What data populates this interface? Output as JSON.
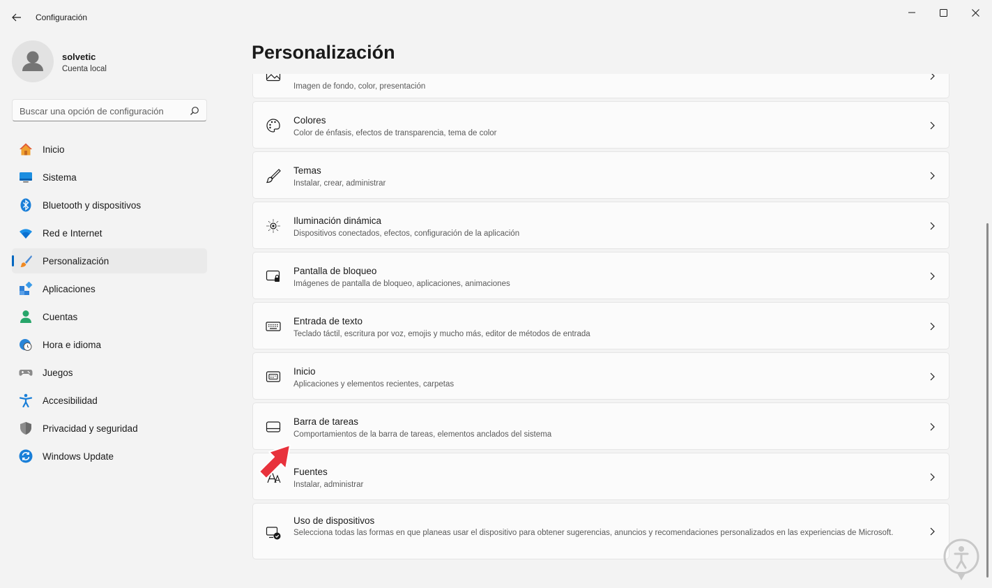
{
  "window": {
    "title": "Configuración"
  },
  "profile": {
    "name": "solvetic",
    "account_type": "Cuenta local"
  },
  "search": {
    "placeholder": "Buscar una opción de configuración"
  },
  "nav": {
    "items": [
      {
        "label": "Inicio",
        "icon": "home-icon"
      },
      {
        "label": "Sistema",
        "icon": "monitor-icon"
      },
      {
        "label": "Bluetooth y dispositivos",
        "icon": "bluetooth-icon"
      },
      {
        "label": "Red e Internet",
        "icon": "wifi-icon"
      },
      {
        "label": "Personalización",
        "icon": "paintbrush-icon",
        "active": true
      },
      {
        "label": "Aplicaciones",
        "icon": "apps-icon"
      },
      {
        "label": "Cuentas",
        "icon": "person-icon"
      },
      {
        "label": "Hora e idioma",
        "icon": "globe-clock-icon"
      },
      {
        "label": "Juegos",
        "icon": "gamepad-icon"
      },
      {
        "label": "Accesibilidad",
        "icon": "accessibility-icon"
      },
      {
        "label": "Privacidad y seguridad",
        "icon": "shield-icon"
      },
      {
        "label": "Windows Update",
        "icon": "update-icon"
      }
    ]
  },
  "main": {
    "title": "Personalización",
    "cards": [
      {
        "title": "",
        "desc": "Imagen de fondo, color, presentación",
        "icon": "image-icon"
      },
      {
        "title": "Colores",
        "desc": "Color de énfasis, efectos de transparencia, tema de color",
        "icon": "palette-icon"
      },
      {
        "title": "Temas",
        "desc": "Instalar, crear, administrar",
        "icon": "brush-icon"
      },
      {
        "title": "Iluminación dinámica",
        "desc": "Dispositivos conectados, efectos, configuración de la aplicación",
        "icon": "sun-icon"
      },
      {
        "title": "Pantalla de bloqueo",
        "desc": "Imágenes de pantalla de bloqueo, aplicaciones, animaciones",
        "icon": "lock-screen-icon"
      },
      {
        "title": "Entrada de texto",
        "desc": "Teclado táctil, escritura por voz, emojis y mucho más, editor de métodos de entrada",
        "icon": "keyboard-icon"
      },
      {
        "title": "Inicio",
        "desc": "Aplicaciones y elementos recientes, carpetas",
        "icon": "start-icon"
      },
      {
        "title": "Barra de tareas",
        "desc": "Comportamientos de la barra de tareas, elementos anclados del sistema",
        "icon": "taskbar-icon"
      },
      {
        "title": "Fuentes",
        "desc": "Instalar, administrar",
        "icon": "fonts-icon"
      },
      {
        "title": "Uso de dispositivos",
        "desc": "Selecciona todas las formas en que planeas usar el dispositivo para obtener sugerencias, anuncios y recomendaciones personalizados en las experiencias de Microsoft.",
        "icon": "device-usage-icon"
      }
    ]
  },
  "colors": {
    "accent": "#0067c0",
    "annotation": "#e8323c"
  }
}
